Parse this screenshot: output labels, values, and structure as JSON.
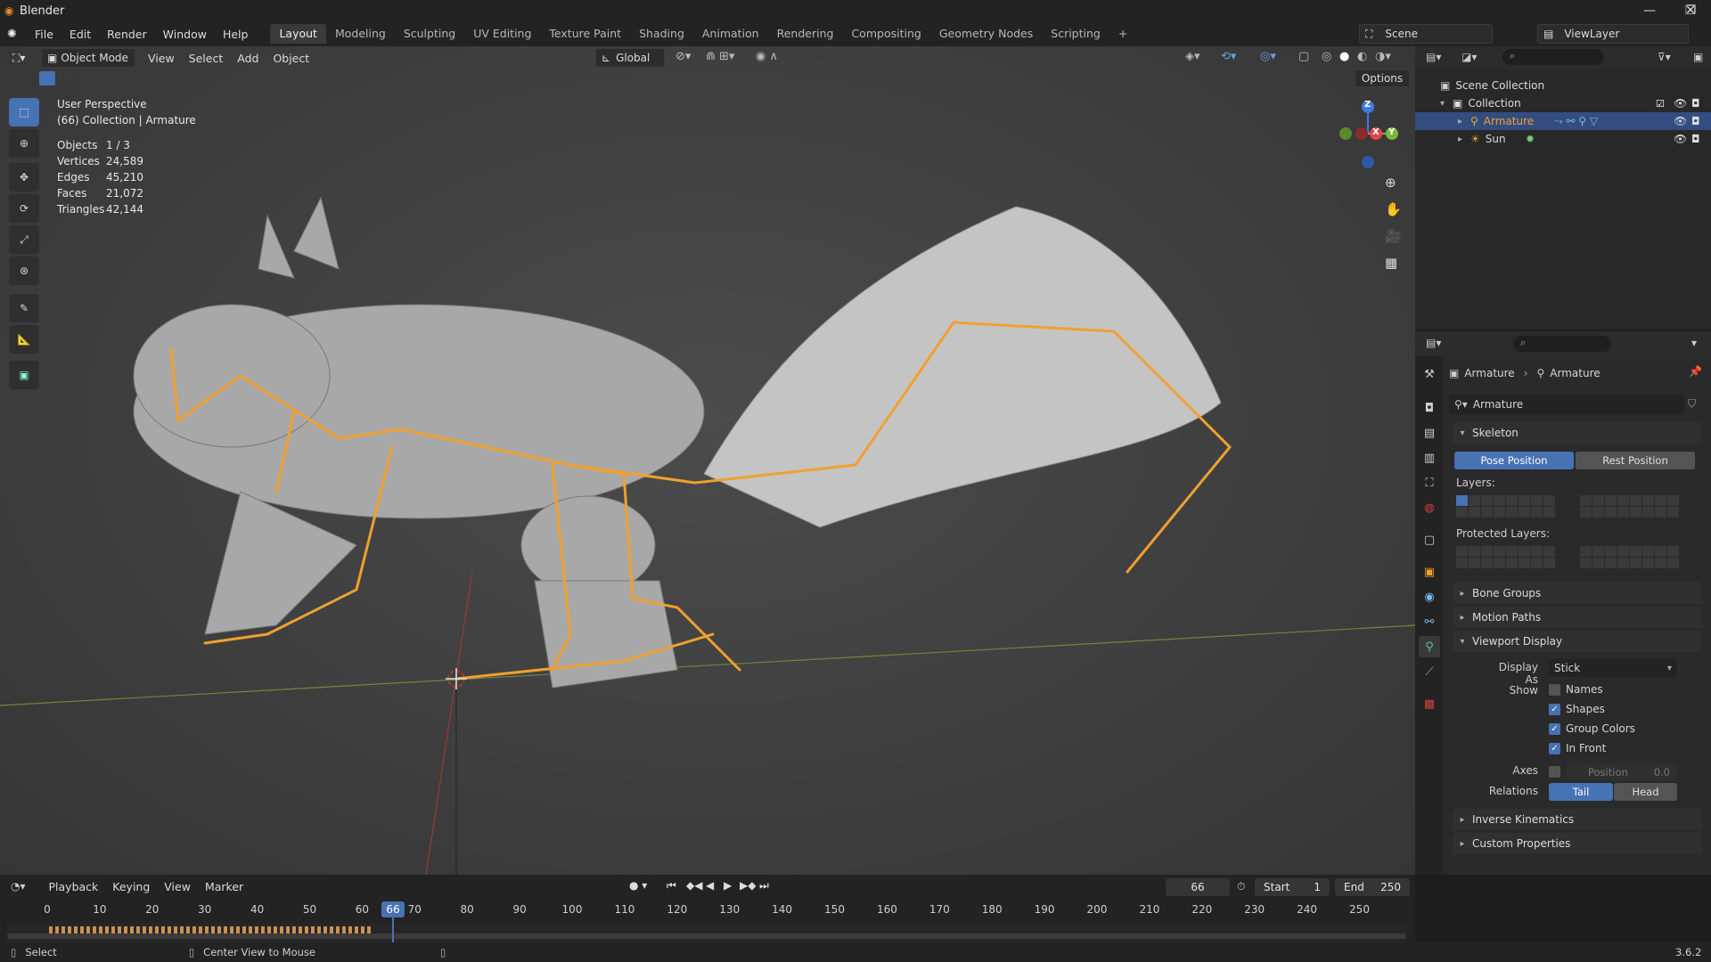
{
  "window": {
    "title": "Blender"
  },
  "menu": [
    "File",
    "Edit",
    "Render",
    "Window",
    "Help"
  ],
  "workspaces": [
    "Layout",
    "Modeling",
    "Sculpting",
    "UV Editing",
    "Texture Paint",
    "Shading",
    "Animation",
    "Rendering",
    "Compositing",
    "Geometry Nodes",
    "Scripting"
  ],
  "active_workspace": "Layout",
  "scene": {
    "name": "Scene",
    "view_layer": "ViewLayer"
  },
  "viewport_header": {
    "mode": "Object Mode",
    "menus": [
      "View",
      "Select",
      "Add",
      "Object"
    ],
    "orientation": "Global",
    "options": "Options"
  },
  "overlay": {
    "view_name": "User Perspective",
    "context": "(66) Collection | Armature",
    "stats": [
      {
        "k": "Objects",
        "v": "1 / 3"
      },
      {
        "k": "Vertices",
        "v": "24,589"
      },
      {
        "k": "Edges",
        "v": "45,210"
      },
      {
        "k": "Faces",
        "v": "21,072"
      },
      {
        "k": "Triangles",
        "v": "42,144"
      }
    ]
  },
  "gizmo": {
    "x": "X",
    "y": "Y",
    "z": "Z"
  },
  "outliner": {
    "root": "Scene Collection",
    "collection": "Collection",
    "items": [
      "Armature",
      "Sun"
    ]
  },
  "properties": {
    "breadcrumb_a": "Armature",
    "breadcrumb_b": "Armature",
    "datablock": "Armature",
    "skeleton": "Skeleton",
    "pose_position": "Pose Position",
    "rest_position": "Rest Position",
    "layers": "Layers:",
    "protected_layers": "Protected Layers:",
    "bone_groups": "Bone Groups",
    "motion_paths": "Motion Paths",
    "viewport_display": "Viewport Display",
    "display_as_label": "Display As",
    "display_as_value": "Stick",
    "show_label": "Show",
    "show": [
      {
        "label": "Names",
        "checked": false
      },
      {
        "label": "Shapes",
        "checked": true
      },
      {
        "label": "Group Colors",
        "checked": true
      },
      {
        "label": "In Front",
        "checked": true
      }
    ],
    "axes_label": "Axes",
    "axes_position": "Position",
    "axes_value": "0.0",
    "relations_label": "Relations",
    "relations_tail": "Tail",
    "relations_head": "Head",
    "inverse_kinematics": "Inverse Kinematics",
    "custom_properties": "Custom Properties"
  },
  "timeline": {
    "menus": [
      "Playback",
      "Keying",
      "View",
      "Marker"
    ],
    "current_frame": "66",
    "start_label": "Start",
    "start": "1",
    "end_label": "End",
    "end": "250",
    "ticks": [
      "0",
      "10",
      "20",
      "30",
      "40",
      "50",
      "60",
      "70",
      "80",
      "90",
      "100",
      "110",
      "120",
      "130",
      "140",
      "150",
      "160",
      "170",
      "180",
      "190",
      "200",
      "210",
      "220",
      "230",
      "240",
      "250"
    ]
  },
  "statusbar": {
    "select": "Select",
    "center": "Center View to Mouse",
    "version": "3.6.2"
  },
  "colors": {
    "accent": "#4772b3",
    "bone": "#f0a030",
    "selected_row": "#334d80"
  }
}
